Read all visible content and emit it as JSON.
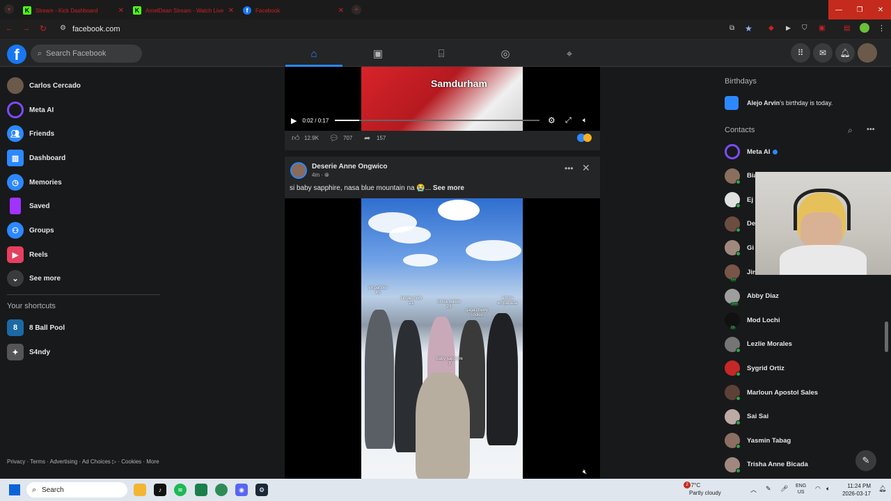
{
  "browser": {
    "tabs": [
      {
        "title": "Stream - Kick Dashboard",
        "favicon": "K"
      },
      {
        "title": "ArnelDean Stream - Watch Live",
        "favicon": "K"
      },
      {
        "title": "Facebook",
        "favicon": "f"
      }
    ],
    "url": "facebook.com"
  },
  "fb": {
    "search_placeholder": "Search Facebook",
    "nav": [
      "home",
      "video",
      "marketplace",
      "groups",
      "gaming"
    ]
  },
  "sidebar": {
    "items": [
      {
        "label": "Carlos Cercado",
        "icon": "profile-avatar",
        "color": "#6b5a4a"
      },
      {
        "label": "Meta AI",
        "icon": "meta-ai-icon",
        "color": "#7b4cff"
      },
      {
        "label": "Friends",
        "icon": "friends-icon",
        "color": "#2d88ff"
      },
      {
        "label": "Dashboard",
        "icon": "dashboard-icon",
        "color": "#2d88ff"
      },
      {
        "label": "Memories",
        "icon": "memories-icon",
        "color": "#2d88ff"
      },
      {
        "label": "Saved",
        "icon": "saved-icon",
        "color": "#a033ff"
      },
      {
        "label": "Groups",
        "icon": "groups-icon",
        "color": "#2d88ff"
      },
      {
        "label": "Reels",
        "icon": "reels-icon",
        "color": "#e4405f"
      },
      {
        "label": "See more",
        "icon": "chevron-down-icon",
        "color": "#3a3b3c"
      }
    ],
    "shortcuts_heading": "Your shortcuts",
    "shortcuts": [
      {
        "label": "8 Ball Pool",
        "color": "#1b6aa5"
      },
      {
        "label": "S4ndy",
        "color": "#555"
      }
    ],
    "footer": "Privacy · Terms · Advertising · Ad Choices ▷ · Cookies · More"
  },
  "post1": {
    "overlay_text": "Samdurham",
    "time": "0:02 / 0:17",
    "progress": 0.12,
    "likes": "12.9K",
    "comments": "707",
    "shares": "157"
  },
  "post2": {
    "author": "Deserie Anne Ongwico",
    "time": "4m",
    "text": "si baby sapphire, nasa blue mountain na 😭...",
    "see_more": "See more",
    "labels": [
      {
        "text": "ex partner\n45"
      },
      {
        "text": "single mom\n21"
      },
      {
        "text": "binda walker\n29"
      },
      {
        "text": "gaga chewy\ncookie"
      },
      {
        "text": "adcos\nempanada"
      },
      {
        "text": "baby sapphire\n3"
      }
    ]
  },
  "right": {
    "birthdays_heading": "Birthdays",
    "birthday_name": "Alejo Arvin",
    "birthday_text": "'s birthday is today.",
    "contacts_heading": "Contacts",
    "contacts": [
      {
        "name": "Meta AI",
        "color": "#7b4cff",
        "online": false,
        "tag": ""
      },
      {
        "name": "Bia",
        "color": "#8b6f5e",
        "online": true,
        "tag": ""
      },
      {
        "name": "Ej",
        "color": "#e0e0e0",
        "online": true,
        "tag": ""
      },
      {
        "name": "De",
        "color": "#6d4c41",
        "online": true,
        "tag": ""
      },
      {
        "name": "Gi",
        "color": "#a1887f",
        "online": true,
        "tag": ""
      },
      {
        "name": "Jin",
        "color": "#795548",
        "online": false,
        "tag": "6m"
      },
      {
        "name": "Abby Diaz",
        "color": "#9e9e9e",
        "online": false,
        "tag": "35m"
      },
      {
        "name": "Mod Lochi",
        "color": "#111111",
        "online": false,
        "tag": "1h"
      },
      {
        "name": "Lezlie Morales",
        "color": "#757575",
        "online": true,
        "tag": ""
      },
      {
        "name": "Sygrid Ortiz",
        "color": "#c62828",
        "online": true,
        "tag": ""
      },
      {
        "name": "Marloun Apostol Sales",
        "color": "#5d4037",
        "online": true,
        "tag": ""
      },
      {
        "name": "Sai Sai",
        "color": "#bcaaa4",
        "online": true,
        "tag": ""
      },
      {
        "name": "Yasmin Tabag",
        "color": "#8d6e63",
        "online": true,
        "tag": ""
      },
      {
        "name": "Trisha Anne Bicada",
        "color": "#a1887f",
        "online": true,
        "tag": ""
      }
    ]
  },
  "taskbar": {
    "search": "Search",
    "temp": "-7°C",
    "weather": "Partly cloudy",
    "lang1": "ENG",
    "lang2": "US",
    "time": "11:24 PM",
    "date": "2026-03-17",
    "notif": "2"
  }
}
